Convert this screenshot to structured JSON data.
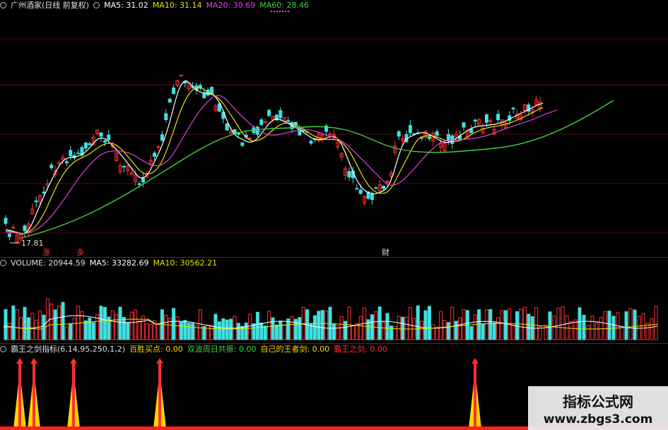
{
  "price_panel": {
    "title": "广州酒家(日线 前复权)",
    "ma5": "MA5: 31.02",
    "ma10": "MA10: 31.14",
    "ma20": "MA20: 30.69",
    "ma60": "MA60: 28.46",
    "low_label": "17.81",
    "marker_1": "涨",
    "marker_2": "多",
    "marker_3": "财",
    "colors": {
      "ma5": "#ffffff",
      "ma10": "#e6e600",
      "ma20": "#e040e0",
      "ma60": "#40d040",
      "up": "#ff3030",
      "down": "#40e0e0"
    }
  },
  "volume_panel": {
    "title": "VOLUME: 20944.59",
    "ma5": "MA5: 33282.69",
    "ma10": "MA10: 30562.21"
  },
  "indicator_panel": {
    "title": "霸王之剑指标(6,14,95,250,1,2)",
    "f1": "百胜买点: 0.00",
    "f2": "双波周日共振: 0.00",
    "f3": "自己的王者剑: 0.00",
    "f4": "霸王之剑: 0.00",
    "colors": {
      "f1": "#ffd700",
      "f2": "#40d040",
      "f3": "#ffd700",
      "f4": "#ff3030"
    }
  },
  "watermark": {
    "title": "指标公式网",
    "url": "www.zbgs3.com"
  }
}
